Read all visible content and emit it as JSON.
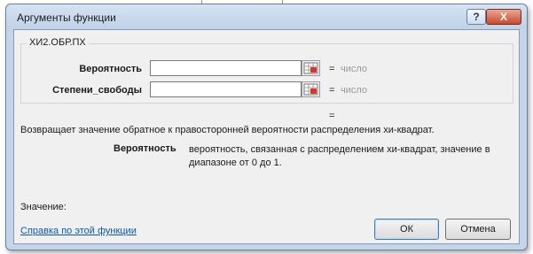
{
  "dialog": {
    "title": "Аргументы функции",
    "help_button": "?",
    "close_button": "X"
  },
  "function": {
    "name": "ХИ2.ОБР.ПХ",
    "arguments": [
      {
        "label": "Вероятность",
        "value": "",
        "equals": "=",
        "hint": "число"
      },
      {
        "label": "Степени_свободы",
        "value": "",
        "equals": "=",
        "hint": "число"
      }
    ],
    "result_equals": "=",
    "description": "Возвращает значение обратное к правосторонней вероятности распределения хи-квадрат.",
    "param_name": "Вероятность",
    "param_description": "вероятность, связанная с распределением хи-квадрат, значение в диапазоне от 0 до 1."
  },
  "footer": {
    "value_label": "Значение:",
    "help_link": "Справка по этой функции",
    "ok_label": "ОК",
    "cancel_label": "Отмена"
  }
}
